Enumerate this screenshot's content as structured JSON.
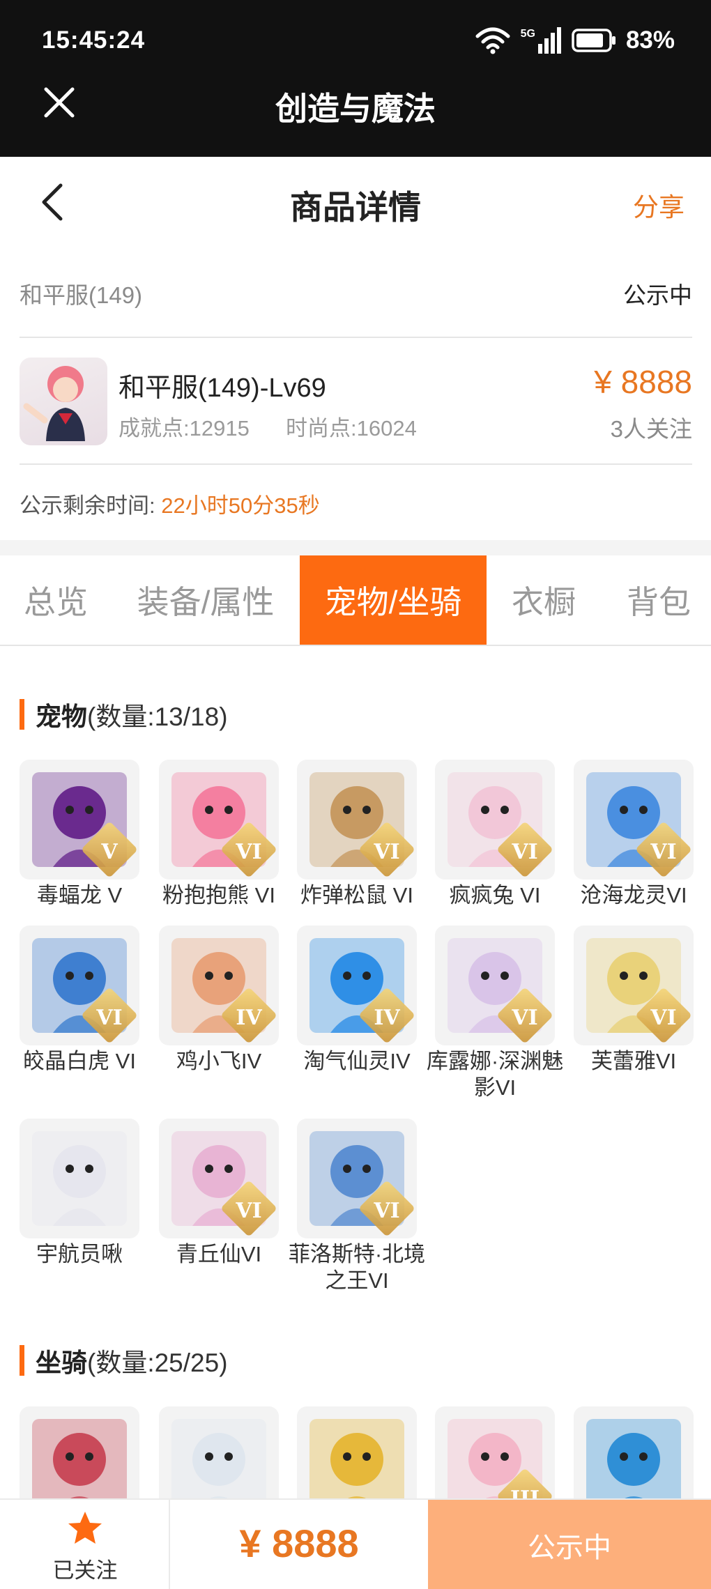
{
  "status_bar": {
    "time": "15:45:24",
    "network": "5G",
    "battery": "83%"
  },
  "app_bar": {
    "title": "创造与魔法"
  },
  "header": {
    "title": "商品详情",
    "share": "分享"
  },
  "server": {
    "name": "和平服(149)",
    "status": "公示中"
  },
  "product": {
    "name": "和平服(149)-Lv69",
    "achievement": "成就点:12915",
    "fashion": "时尚点:16024",
    "price": "¥ 8888",
    "followers": "3人关注"
  },
  "countdown": {
    "label": "公示剩余时间:",
    "value": "22小时50分35秒"
  },
  "tabs": [
    "总览",
    "装备/属性",
    "宠物/坐骑",
    "衣橱",
    "背包"
  ],
  "active_tab": "宠物/坐骑",
  "pets": {
    "title": "宠物",
    "count": "(数量:13/18)",
    "items": [
      {
        "name": "毒蝠龙 V",
        "rank": "V",
        "color": "#6a2a8e"
      },
      {
        "name": "粉抱抱熊 VI",
        "rank": "VI",
        "color": "#f47fa0"
      },
      {
        "name": "炸弹松鼠 VI",
        "rank": "VI",
        "color": "#c79a62"
      },
      {
        "name": "疯疯兔 VI",
        "rank": "VI",
        "color": "#f2c7d8"
      },
      {
        "name": "沧海龙灵VI",
        "rank": "VI",
        "color": "#4a8fe0"
      },
      {
        "name": "皎晶白虎 VI",
        "rank": "VI",
        "color": "#3f7fd0"
      },
      {
        "name": "鸡小飞IV",
        "rank": "IV",
        "color": "#e8a27a"
      },
      {
        "name": "淘气仙灵IV",
        "rank": "IV",
        "color": "#2f8fe6"
      },
      {
        "name": "库露娜·深渊魅影VI",
        "rank": "VI",
        "color": "#d9c4e8"
      },
      {
        "name": "芙蕾雅VI",
        "rank": "VI",
        "color": "#e9d27a"
      },
      {
        "name": "宇航员啾",
        "rank": "",
        "color": "#e6e6ee"
      },
      {
        "name": "青丘仙VI",
        "rank": "VI",
        "color": "#e8b4d4"
      },
      {
        "name": "菲洛斯特·北境之王VI",
        "rank": "VI",
        "color": "#5c8fd2"
      }
    ]
  },
  "mounts": {
    "title": "坐骑",
    "count": "(数量:25/25)",
    "items": [
      {
        "name": "",
        "rank": "",
        "color": "#c94a5a"
      },
      {
        "name": "",
        "rank": "",
        "color": "#dfe6ee"
      },
      {
        "name": "",
        "rank": "",
        "color": "#e6b83a"
      },
      {
        "name": "",
        "rank": "III",
        "color": "#f3b6c8"
      },
      {
        "name": "",
        "rank": "",
        "color": "#2f8fd6"
      }
    ]
  },
  "bottom": {
    "follow_label": "已关注",
    "price": "¥ 8888",
    "status_button": "公示中"
  }
}
